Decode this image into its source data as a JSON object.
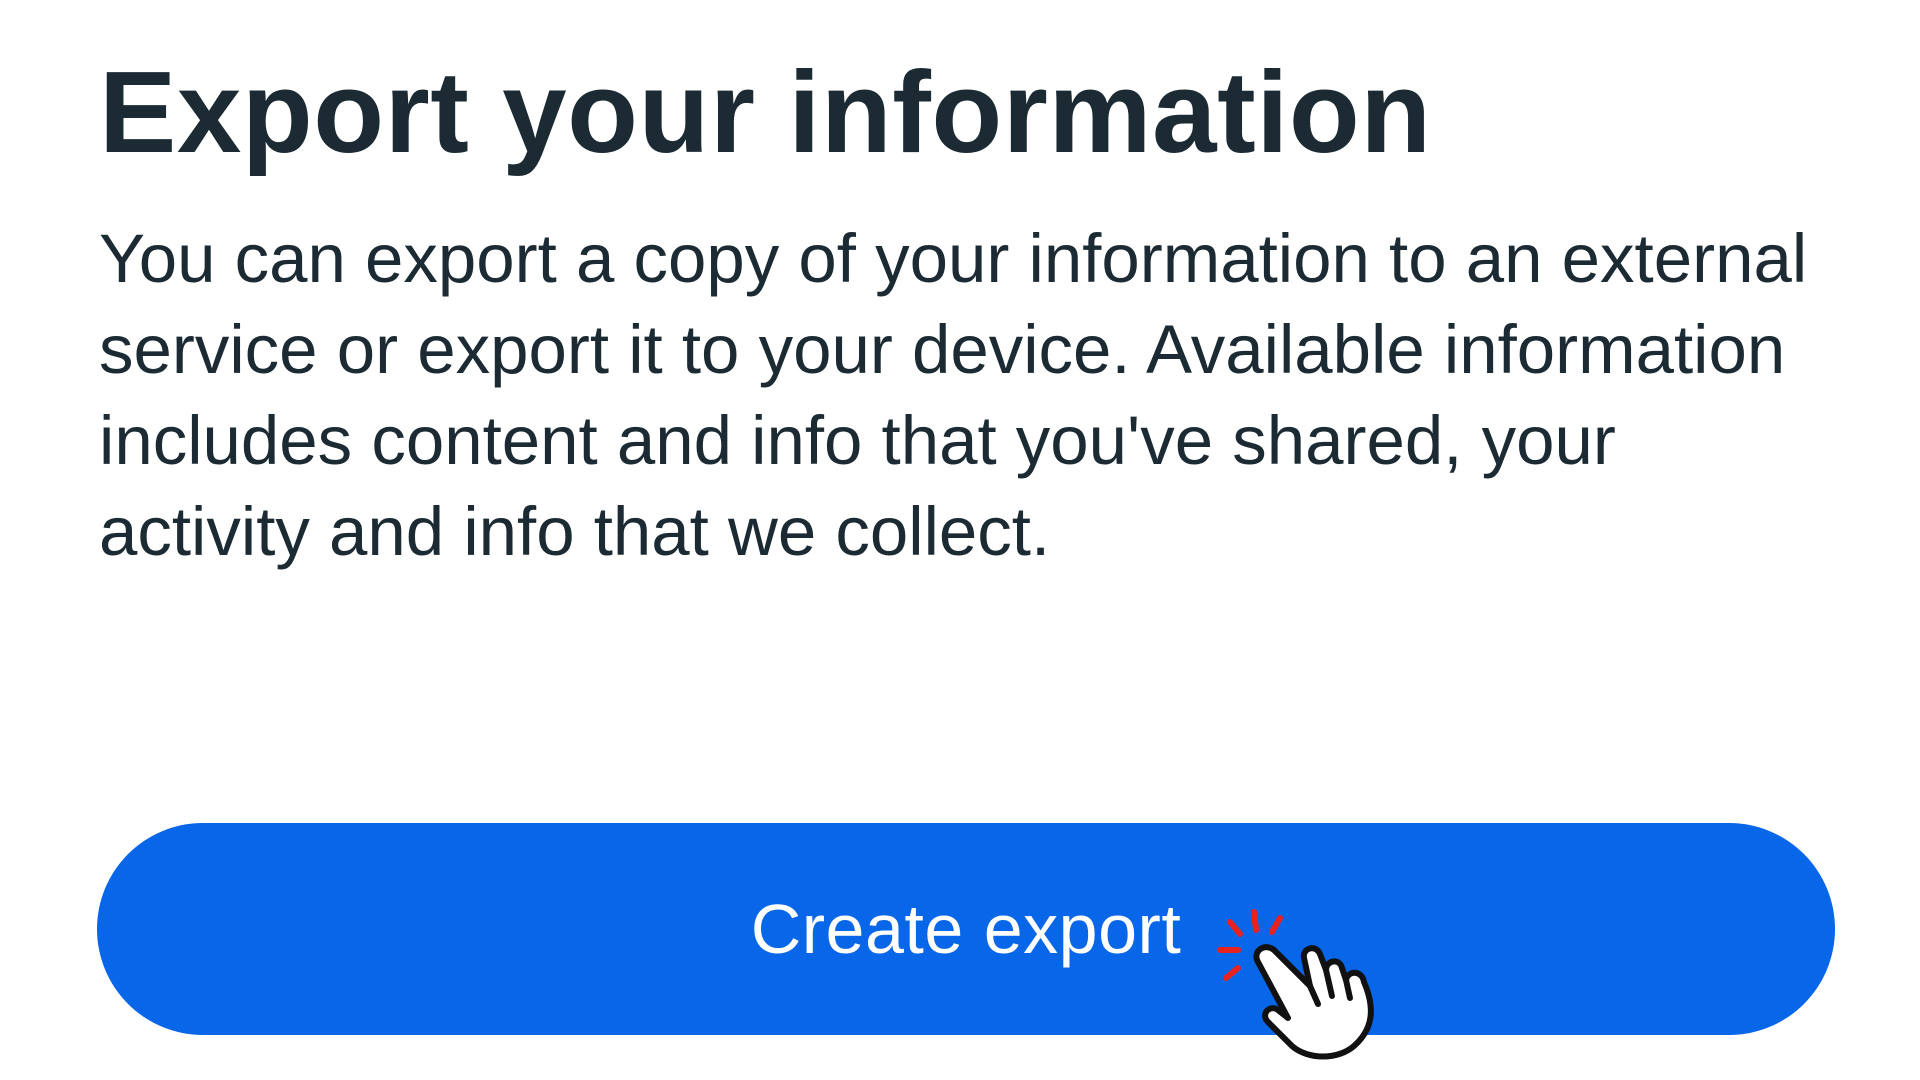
{
  "header": {
    "title": "Export your information"
  },
  "main": {
    "description": "You can export a copy of your information to an external service or export it to your device. Available information includes content and info that you've shared, your activity and info that we collect."
  },
  "actions": {
    "create_export_label": "Create export"
  },
  "colors": {
    "primary_button": "#0866e8",
    "text": "#1c2b33",
    "tap_sparkle": "#e8231f"
  },
  "icons": {
    "tap_indicator": "pointing-hand-tap-icon"
  }
}
